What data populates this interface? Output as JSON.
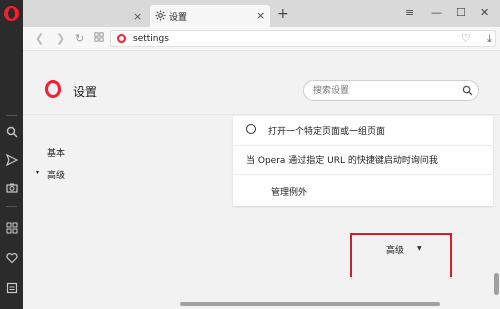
{
  "tabs": [
    {
      "label": "",
      "close": "×"
    },
    {
      "label": "设置",
      "close": "×",
      "icon": "gear-icon"
    }
  ],
  "new_tab": "+",
  "window_controls": {
    "menu": "≡",
    "minimize": "—",
    "maximize": "☐",
    "close": "✕"
  },
  "address": {
    "url": "settings"
  },
  "settings": {
    "title": "设置",
    "search_placeholder": "搜索设置"
  },
  "nav": {
    "basic": "基本",
    "advanced": "高级",
    "advanced_caret": "▾"
  },
  "startup_card": {
    "option_specific_pages": "打开一个特定页面或一组页面",
    "ask_shortcut": "当 Opera 通过指定 URL 的快捷键启动时询问我",
    "manage_exceptions": "管理例外"
  },
  "advanced_section": {
    "label": "高级",
    "caret": "▼"
  },
  "colors": {
    "accent": "#ff1b2d",
    "highlight_box": "#d21f2b",
    "sidebar_bg": "#2b2b2b"
  }
}
